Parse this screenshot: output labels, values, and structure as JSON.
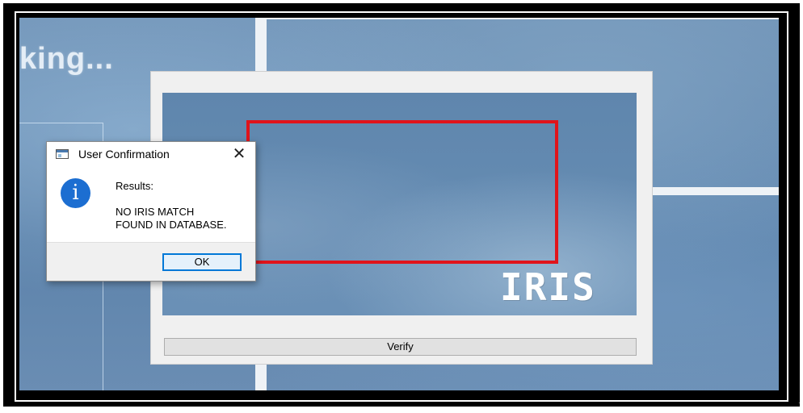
{
  "background": {
    "title_fragment": "king..."
  },
  "capture_window": {
    "watermark": "IRIS",
    "verify_label": "Verify",
    "highlight_color": "#e0141b"
  },
  "dialog": {
    "title": "User Confirmation",
    "close_glyph": "✕",
    "icon": "info-icon",
    "info_glyph": "i",
    "results_label": "Results:",
    "message_line1": "NO IRIS MATCH",
    "message_line2": "FOUND IN DATABASE.",
    "ok_label": "OK"
  },
  "colors": {
    "info_icon": "#1c6ed1",
    "focus_border": "#0078d7"
  },
  "trailing_mark": "."
}
